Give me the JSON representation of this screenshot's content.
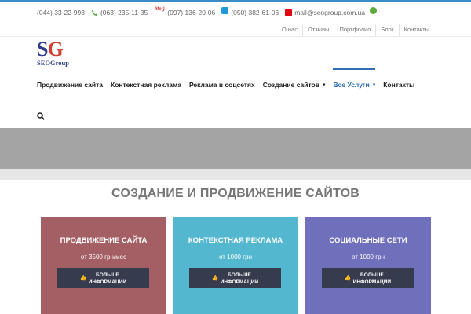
{
  "contacts": [
    {
      "icon": "phone-icon",
      "text": "(044) 33-22-993"
    },
    {
      "icon": "kyivstar-icon",
      "text": "(063) 235-11-35"
    },
    {
      "icon": "life-icon",
      "icon_text": "life:)",
      "text": "(097) 136-20-06"
    },
    {
      "icon": "mts-icon",
      "text": "(050) 382-61-06"
    },
    {
      "icon": "email-icon",
      "text": "mail@seogroup.com.ua"
    }
  ],
  "topnav": [
    "О нас",
    "Отзывы",
    "Портфолио",
    "Блог",
    "Контакты"
  ],
  "logo": {
    "letter1": "S",
    "letter2": "G",
    "subtitle": "SEOGroup"
  },
  "mainnav": [
    {
      "label": "Продвижение сайта",
      "dropdown": false,
      "active": false
    },
    {
      "label": "Контекстная реклама",
      "dropdown": false,
      "active": false
    },
    {
      "label": "Реклама в соцсетях",
      "dropdown": false,
      "active": false
    },
    {
      "label": "Создание сайтов",
      "dropdown": true,
      "active": false
    },
    {
      "label": "Все Услуги",
      "dropdown": true,
      "active": true
    },
    {
      "label": "Контакты",
      "dropdown": false,
      "active": false
    }
  ],
  "section": {
    "heading": "СОЗДАНИЕ И ПРОДВИЖЕНИЕ САЙТОВ"
  },
  "cards": [
    {
      "title": "ПРОДВИЖЕНИЕ САЙТА",
      "price": "от 3500 грн/мес",
      "button": "БОЛЬШЕ\nИНФОРМАЦИИ",
      "color": "#a35f63"
    },
    {
      "title": "КОНТЕКСТНАЯ РЕКЛАМА",
      "price": "от 1000 грн",
      "button": "БОЛЬШЕ\nИНФОРМАЦИИ",
      "color": "#52b7cf"
    },
    {
      "title": "СОЦИАЛЬНЫЕ СЕТИ",
      "price": "от 1000 грн",
      "button": "БОЛЬШЕ\nИНФОРМАЦИИ",
      "color": "#6f6fbb"
    }
  ],
  "colors": {
    "accent": "#2f6fb5",
    "hero_band": "#a4a4a4",
    "button_bg": "#363b4d"
  }
}
